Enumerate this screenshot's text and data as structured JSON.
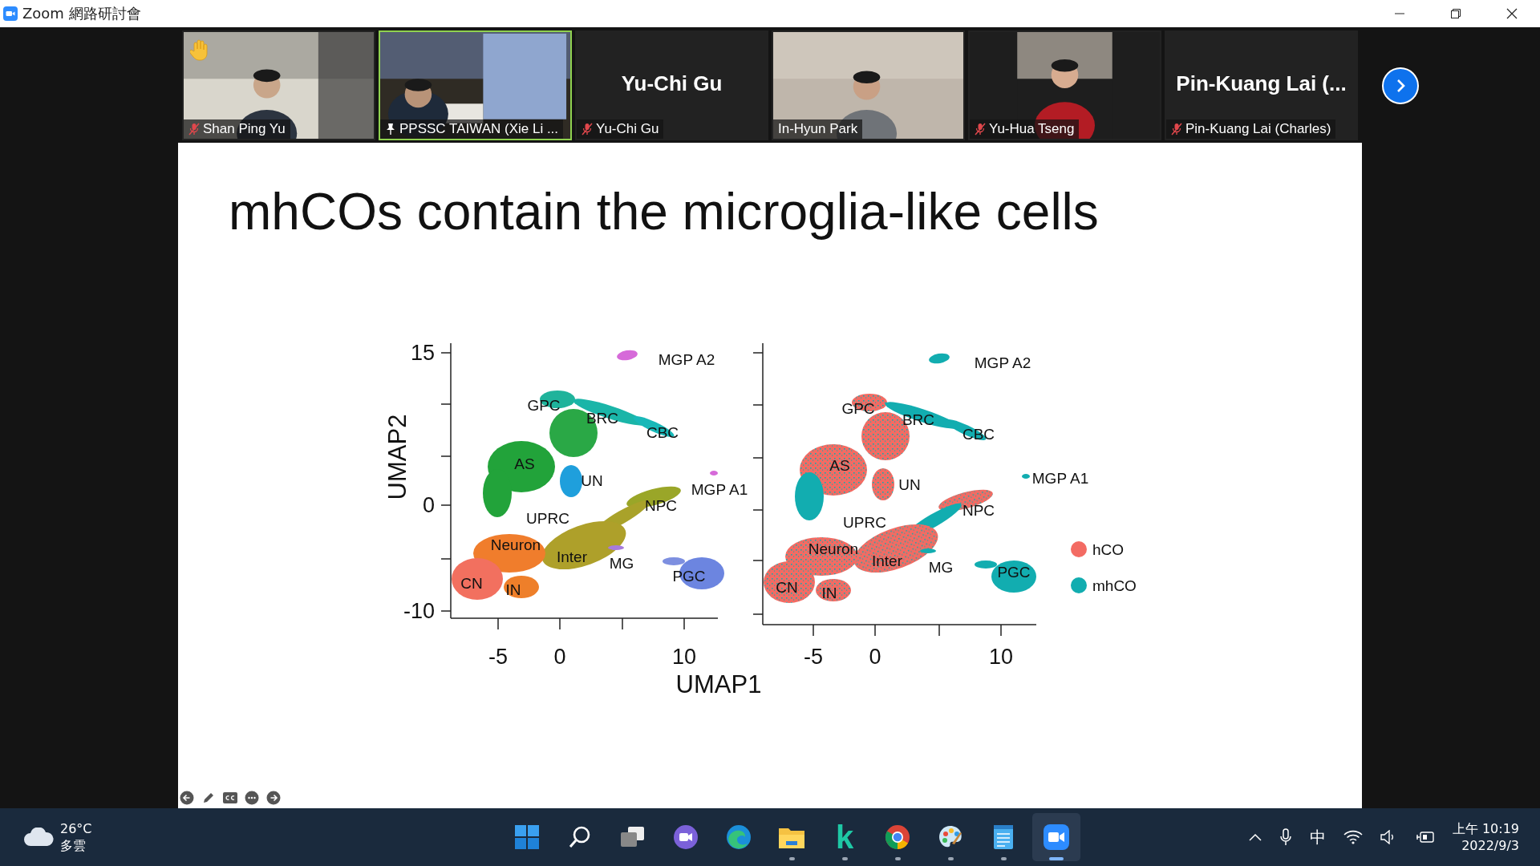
{
  "window": {
    "title": "Zoom 網路研討會"
  },
  "participants": [
    {
      "name": "Shan Ping Yu",
      "kind": "video",
      "muted": true,
      "pinned": false,
      "hand_raised": true,
      "speaking": false
    },
    {
      "name": "PPSSC TAIWAN (Xie Li ...",
      "kind": "video",
      "muted": false,
      "pinned": true,
      "hand_raised": false,
      "speaking": true
    },
    {
      "name": "Yu-Chi Gu",
      "kind": "name",
      "display_name": "Yu-Chi Gu",
      "muted": true,
      "pinned": false,
      "hand_raised": false,
      "speaking": false
    },
    {
      "name": "In-Hyun Park",
      "kind": "video",
      "muted": false,
      "pinned": false,
      "hand_raised": false,
      "speaking": false
    },
    {
      "name": "Yu-Hua Tseng",
      "kind": "video",
      "muted": true,
      "pinned": false,
      "hand_raised": false,
      "speaking": false
    },
    {
      "name": "Pin-Kuang Lai (Charles)",
      "kind": "name",
      "display_name": "Pin-Kuang Lai (...",
      "muted": true,
      "pinned": false,
      "hand_raised": false,
      "speaking": false
    }
  ],
  "slide": {
    "title": "mhCOs contain the microglia-like cells",
    "figure": {
      "ylabel": "UMAP2",
      "xlabel": "UMAP1",
      "yticks": [
        "15",
        "0",
        "-10"
      ],
      "panels": [
        {
          "kind": "cluster",
          "xticks": [
            "-5",
            "0",
            "10"
          ],
          "labels": [
            "MGP A2",
            "GPC",
            "BRC",
            "CBC",
            "AS",
            "UN",
            "MGP A1",
            "NPC",
            "UPRC",
            "Neuron",
            "Inter",
            "MG",
            "PGC",
            "CN",
            "IN"
          ]
        },
        {
          "kind": "sample",
          "xticks": [
            "-5",
            "0",
            "10"
          ],
          "labels": [
            "MGP A2",
            "GPC",
            "BRC",
            "CBC",
            "AS",
            "UN",
            "MGP A1",
            "NPC",
            "UPRC",
            "Neuron",
            "Inter",
            "MG",
            "PGC",
            "CN",
            "IN"
          ]
        }
      ],
      "legend": [
        {
          "label": "hCO",
          "color": "#f36b63"
        },
        {
          "label": "mhCO",
          "color": "#12adb0"
        }
      ]
    }
  },
  "taskbar": {
    "weather": {
      "temp": "26°C",
      "condition": "多雲"
    },
    "apps": [
      {
        "kind": "start",
        "running": false,
        "active": false
      },
      {
        "kind": "search",
        "running": false,
        "active": false
      },
      {
        "kind": "taskview",
        "running": false,
        "active": false
      },
      {
        "kind": "chat",
        "running": false,
        "active": false
      },
      {
        "kind": "edge",
        "running": false,
        "active": false
      },
      {
        "kind": "files",
        "running": true,
        "active": false
      },
      {
        "kind": "letter",
        "glyph": "k",
        "running": true,
        "active": false
      },
      {
        "kind": "chrome",
        "running": true,
        "active": false
      },
      {
        "kind": "paint",
        "running": true,
        "active": false
      },
      {
        "kind": "notepad",
        "running": true,
        "active": false
      },
      {
        "kind": "zoom",
        "running": true,
        "active": true
      }
    ],
    "ime": "中",
    "time": "上午 10:19",
    "date": "2022/9/3"
  }
}
